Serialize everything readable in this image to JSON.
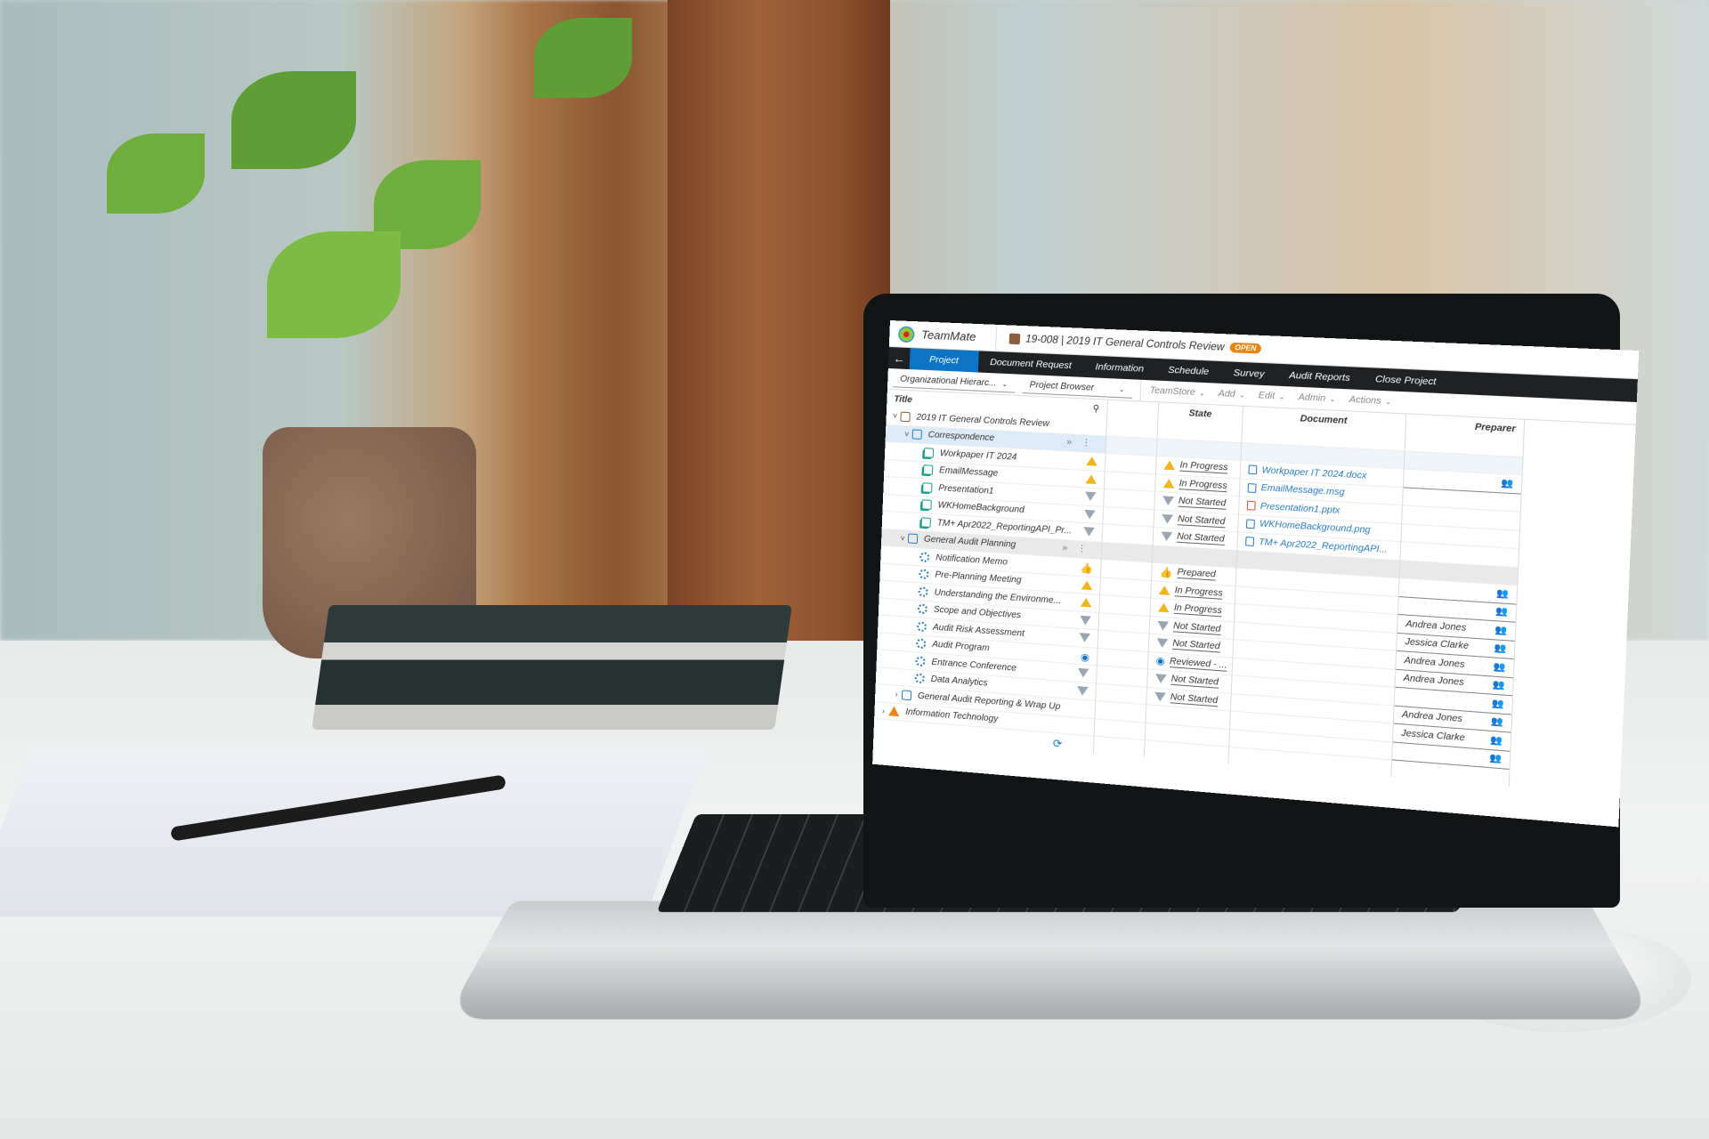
{
  "app": {
    "brand": "TeamMate",
    "project_title": "19-008 | 2019 IT General Controls Review",
    "project_status_badge": "OPEN"
  },
  "nav": {
    "back_icon": "arrow-left-icon",
    "tabs": [
      {
        "label": "Project",
        "active": true
      },
      {
        "label": "Document Request"
      },
      {
        "label": "Information"
      },
      {
        "label": "Schedule"
      },
      {
        "label": "Survey"
      },
      {
        "label": "Audit Reports"
      },
      {
        "label": "Close Project"
      }
    ]
  },
  "toolbar": {
    "hierarchy_dropdown": "Organizational Hierarc...",
    "browser_dropdown": "Project Browser",
    "menus": [
      "TeamStore",
      "Add",
      "Edit",
      "Admin",
      "Actions"
    ]
  },
  "columns": {
    "title": "Title",
    "state": "State",
    "document": "Document",
    "preparer": "Preparer"
  },
  "tree": [
    {
      "title": "2019 IT General Controls Review",
      "icon": "briefcase-icon",
      "level": 0,
      "expanded": true,
      "state": "",
      "document": "",
      "preparer": ""
    },
    {
      "title": "Correspondence",
      "icon": "folder-icon",
      "level": 1,
      "expanded": true,
      "selected": true,
      "state": "",
      "document": "",
      "preparer": ""
    },
    {
      "title": "Workpaper IT 2024",
      "icon": "workpaper-icon",
      "level": 2,
      "status_icon": "in-progress",
      "state": "In Progress",
      "document": "Workpaper IT 2024.docx",
      "doc_icon": "word-file-icon",
      "preparer": ""
    },
    {
      "title": "EmailMessage",
      "icon": "workpaper-icon",
      "level": 2,
      "status_icon": "in-progress",
      "state": "In Progress",
      "document": "EmailMessage.msg",
      "doc_icon": "email-file-icon",
      "preparer": ""
    },
    {
      "title": "Presentation1",
      "icon": "workpaper-icon",
      "level": 2,
      "status_icon": "not-started",
      "state": "Not Started",
      "document": "Presentation1.pptx",
      "doc_icon": "powerpoint-file-icon",
      "preparer": ""
    },
    {
      "title": "WKHomeBackground",
      "icon": "workpaper-icon",
      "level": 2,
      "status_icon": "not-started",
      "state": "Not Started",
      "document": "WKHomeBackground.png",
      "doc_icon": "image-file-icon",
      "preparer": ""
    },
    {
      "title": "TM+ Apr2022_ReportingAPI_Pr...",
      "icon": "workpaper-icon",
      "level": 2,
      "status_icon": "not-started",
      "state": "Not Started",
      "document": "TM+ Apr2022_ReportingAPI...",
      "doc_icon": "file-icon",
      "preparer": ""
    },
    {
      "title": "General Audit Planning",
      "icon": "folder-icon",
      "level": 1,
      "expanded": true,
      "group": true,
      "state": "",
      "document": "",
      "preparer": ""
    },
    {
      "title": "Notification Memo",
      "icon": "procedure-icon",
      "level": 2,
      "status_icon": "prepared",
      "state": "Prepared",
      "document": "",
      "preparer": ""
    },
    {
      "title": "Pre-Planning Meeting",
      "icon": "procedure-icon",
      "level": 2,
      "status_icon": "in-progress",
      "state": "In Progress",
      "document": "",
      "preparer": ""
    },
    {
      "title": "Understanding the Environme...",
      "icon": "procedure-icon",
      "level": 2,
      "status_icon": "in-progress",
      "state": "In Progress",
      "document": "",
      "preparer": "Andrea Jones"
    },
    {
      "title": "Scope and Objectives",
      "icon": "procedure-icon",
      "level": 2,
      "status_icon": "not-started",
      "state": "Not Started",
      "document": "",
      "preparer": "Jessica Clarke"
    },
    {
      "title": "Audit Risk Assessment",
      "icon": "procedure-icon",
      "level": 2,
      "status_icon": "not-started",
      "state": "Not Started",
      "document": "",
      "preparer": "Andrea Jones"
    },
    {
      "title": "Audit Program",
      "icon": "procedure-icon",
      "level": 2,
      "status_icon": "reviewed",
      "state": "Reviewed - ...",
      "document": "",
      "preparer": "Andrea Jones"
    },
    {
      "title": "Entrance Conference",
      "icon": "procedure-icon",
      "level": 2,
      "status_icon": "not-started",
      "state": "Not Started",
      "document": "",
      "preparer": ""
    },
    {
      "title": "Data Analytics",
      "icon": "procedure-icon",
      "level": 2,
      "status_icon": "not-started",
      "state": "Not Started",
      "document": "",
      "preparer": "Andrea Jones"
    },
    {
      "title": "General Audit Reporting & Wrap Up",
      "icon": "folder-icon",
      "level": 1,
      "expanded": false,
      "state": "",
      "document": "",
      "preparer": "Jessica Clarke"
    },
    {
      "title": "Information Technology",
      "icon": "warning-icon",
      "level": 0,
      "expanded": false,
      "state": "",
      "document": "",
      "preparer": ""
    }
  ],
  "footer": {
    "history_icon": "history-icon"
  }
}
